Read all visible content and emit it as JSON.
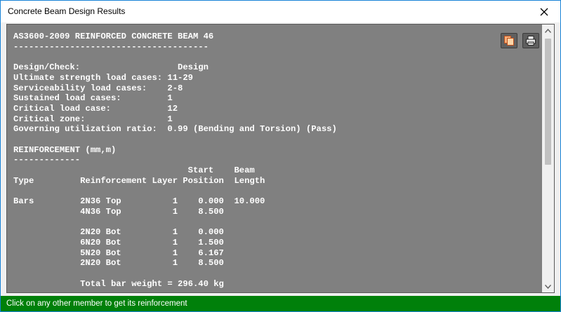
{
  "window": {
    "title": "Concrete Beam Design Results"
  },
  "report": {
    "text": "AS3600-2009 REINFORCED CONCRETE BEAM 46\n--------------------------------------\n\nDesign/Check:                   Design\nUltimate strength load cases: 11-29\nServiceability load cases:    2-8\nSustained load cases:         1\nCritical load case:           12\nCritical zone:                1\nGoverning utilization ratio:  0.99 (Bending and Torsion) (Pass)\n\nREINFORCEMENT (mm,m)\n-------------\n                                  Start    Beam\nType         Reinforcement Layer Position  Length\n\nBars         2N36 Top          1    0.000  10.000\n             4N36 Top          1    8.500\n\n             2N20 Bot          1    0.000\n             6N20 Bot          1    1.500\n             5N20 Bot          1    6.167\n             2N20 Bot          1    8.500\n\n             Total bar weight = 296.40 kg"
  },
  "toolbar": {
    "copy_icon": "copy-icon",
    "print_icon": "print-icon"
  },
  "status": {
    "text": "Click on any other member to get its reinforcement"
  },
  "colors": {
    "report_bg": "#808080",
    "status_bg": "#00800a",
    "border": "#1883d7"
  }
}
